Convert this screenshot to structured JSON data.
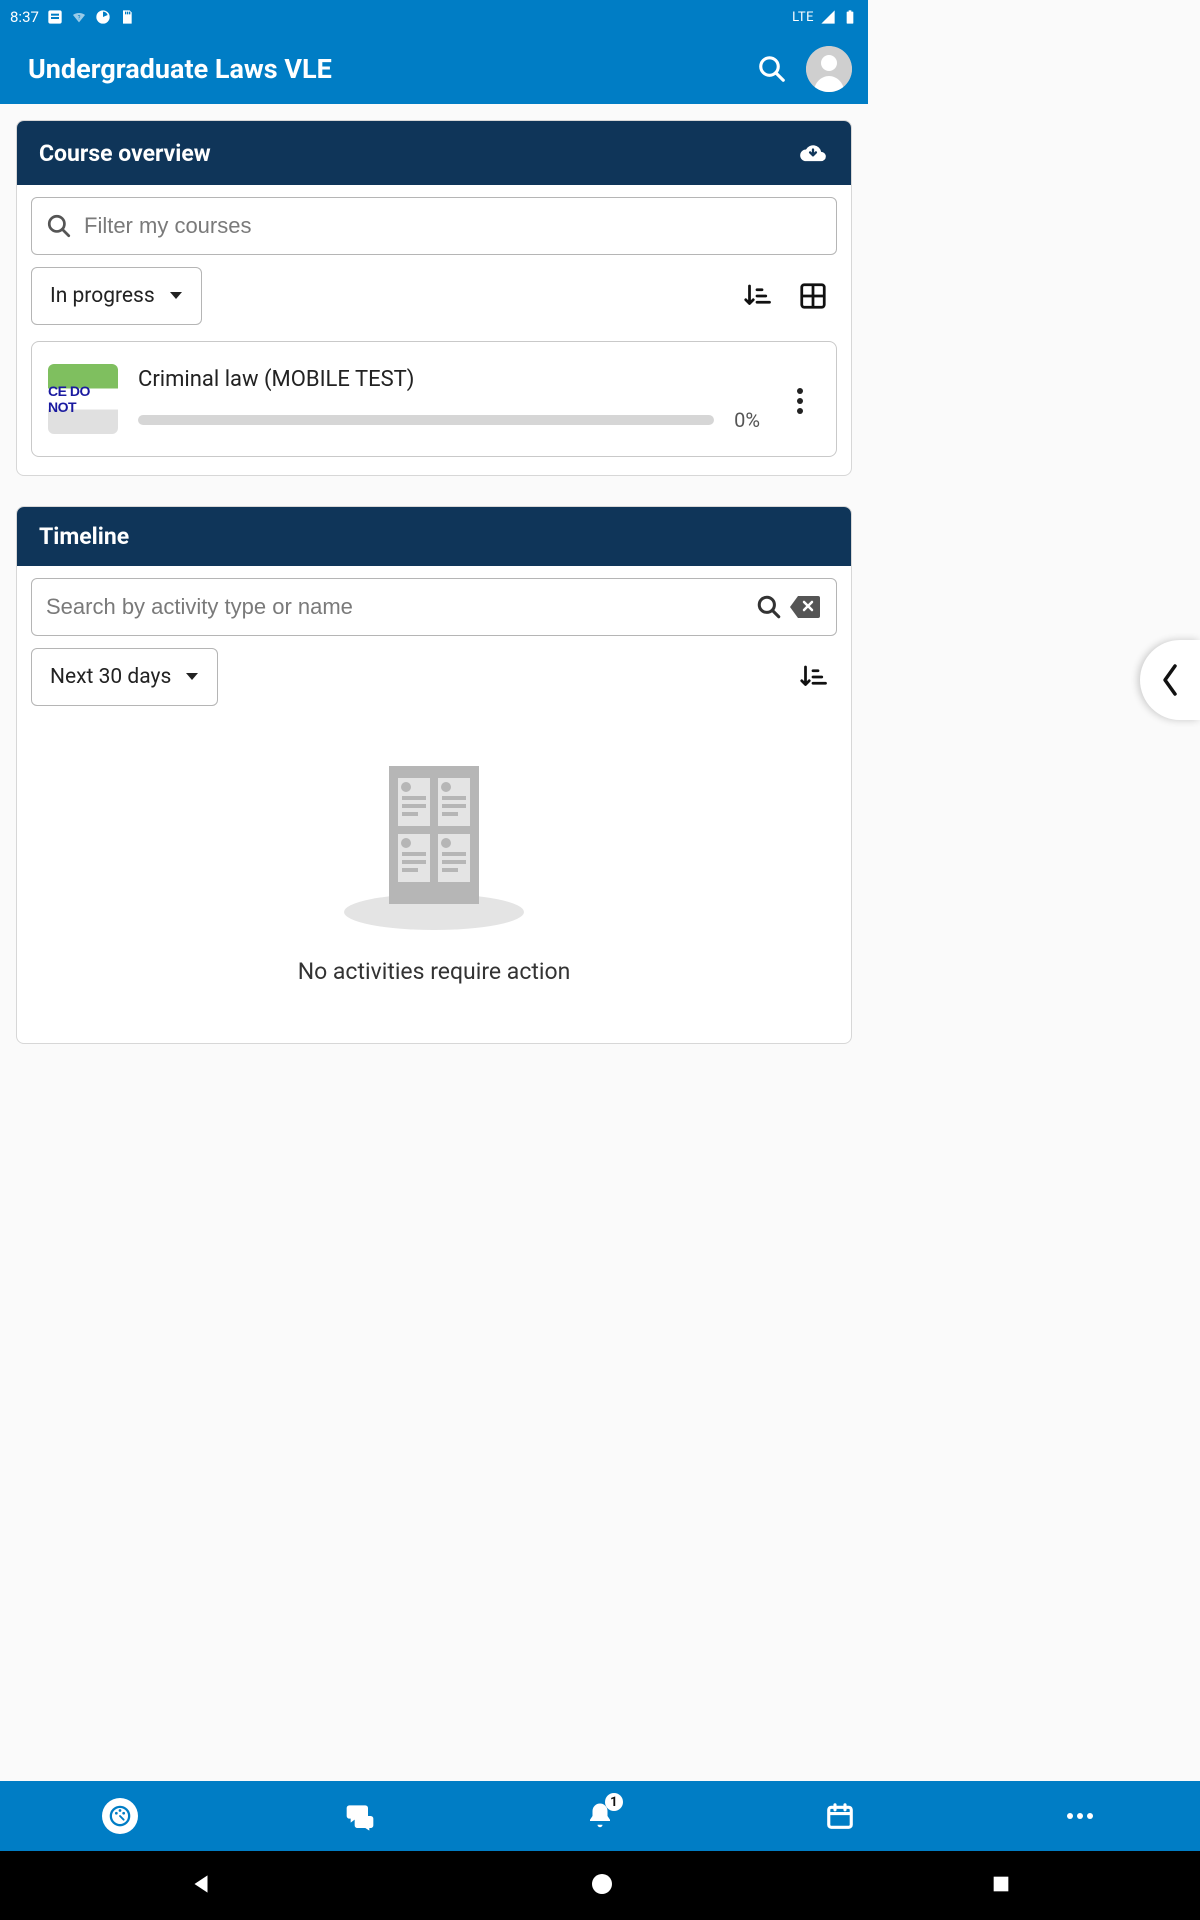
{
  "status_bar": {
    "time": "8:37",
    "network_label": "LTE"
  },
  "header": {
    "title": "Undergraduate Laws VLE"
  },
  "course_overview": {
    "title": "Course overview",
    "filter_placeholder": "Filter my courses",
    "status_filter": "In progress",
    "courses": [
      {
        "title": "Criminal law (MOBILE TEST)",
        "progress_pct": "0%",
        "thumb_text": "CE DO NOT"
      }
    ]
  },
  "timeline": {
    "title": "Timeline",
    "search_placeholder": "Search by activity type or name",
    "range_filter": "Next 30 days",
    "empty_message": "No activities require action"
  },
  "bottom_nav": {
    "badge_count": "1"
  }
}
